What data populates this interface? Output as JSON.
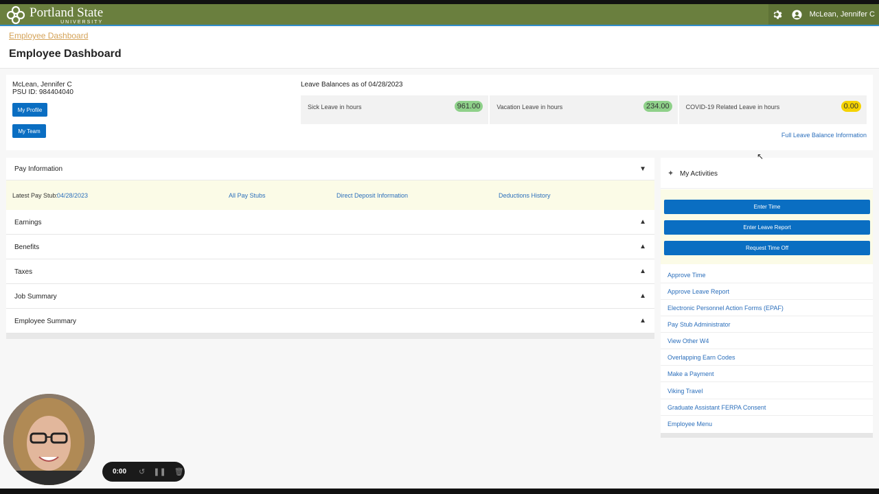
{
  "header": {
    "logo_name": "Portland State",
    "logo_sub": "UNIVERSITY",
    "user_name": "McLean, Jennifer C",
    "icons": [
      "gear-icon",
      "user-icon"
    ]
  },
  "breadcrumb": {
    "label": "Employee Dashboard"
  },
  "page_title": "Employee Dashboard",
  "profile": {
    "name": "McLean, Jennifer C",
    "psu_id": "PSU ID: 984404040",
    "my_profile_label": "My Profile",
    "my_team_label": "My Team"
  },
  "leave": {
    "title": "Leave Balances as of 04/28/2023",
    "items": [
      {
        "label": "Sick Leave in hours",
        "value": "961.00",
        "color": "#8fd18a"
      },
      {
        "label": "Vacation Leave in hours",
        "value": "234.00",
        "color": "#8fd18a"
      },
      {
        "label": "COVID-19 Related Leave in hours",
        "value": "0.00",
        "color": "#f5d300"
      }
    ],
    "full_link": "Full Leave Balance Information"
  },
  "pay": {
    "title": "Pay Information",
    "latest_label": "Latest Pay Stub:",
    "latest_date": "04/28/2023",
    "all_stubs": "All Pay Stubs",
    "direct_deposit": "Direct Deposit Information",
    "deductions": "Deductions History",
    "sections": [
      "Earnings",
      "Benefits",
      "Taxes",
      "Job Summary",
      "Employee Summary"
    ]
  },
  "activities": {
    "title": "My Activities",
    "buttons": [
      "Enter Time",
      "Enter Leave Report",
      "Request Time Off"
    ],
    "links": [
      "Approve Time",
      "Approve Leave Report",
      "Electronic Personnel Action Forms (EPAF)",
      "Pay Stub Administrator",
      "View Other W4",
      "Overlapping Earn Codes",
      "Make a Payment",
      "Viking Travel",
      "Graduate Assistant FERPA Consent",
      "Employee Menu"
    ]
  },
  "recorder": {
    "time": "0:00"
  },
  "colors": {
    "header": "#6a7f3e",
    "accent_blue": "#0a6ec2",
    "link": "#2a6ebb"
  }
}
